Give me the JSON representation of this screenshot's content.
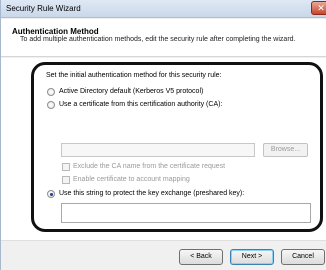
{
  "window": {
    "title": "Security Rule Wizard",
    "close_glyph": "✕"
  },
  "header": {
    "title": "Authentication Method",
    "description": "To add multiple authentication methods, edit the security rule after completing the wizard."
  },
  "main": {
    "instruction": "Set the initial authentication method for this security rule:",
    "options": {
      "active_directory": "Active Directory default (Kerberos V5 protocol)",
      "certificate": "Use a certificate from this certification authority (CA):",
      "preshared_key": "Use this string to protect the key exchange (preshared key):"
    },
    "selected_option": "preshared_key",
    "ca_field_value": "",
    "browse_label": "Browse...",
    "checkboxes": {
      "exclude_ca": "Exclude the CA name from the certificate request",
      "enable_mapping": "Enable certificate to account mapping"
    },
    "preshared_key_value": ""
  },
  "footer": {
    "back_label": "< Back",
    "next_label": "Next >",
    "cancel_label": "Cancel"
  },
  "colors": {
    "highlight_border": "#111111",
    "accent": "#3c7fb1"
  }
}
